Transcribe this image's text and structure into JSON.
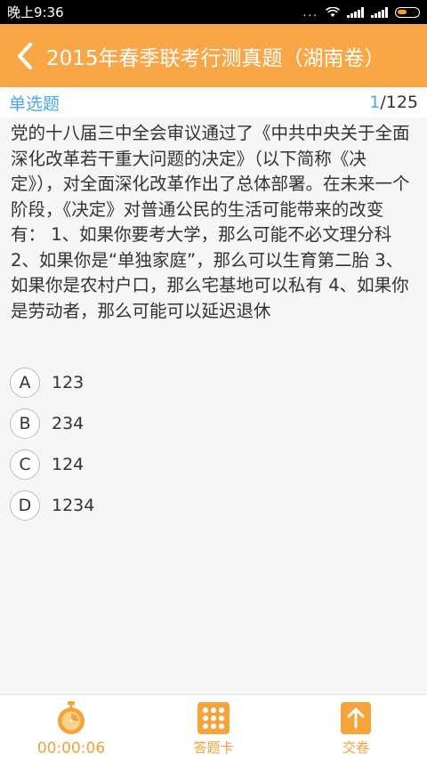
{
  "status_bar": {
    "time": "晚上9:36",
    "more": "..."
  },
  "title_bar": {
    "title": "2015年春季联考行测真题（湖南卷）"
  },
  "question_header": {
    "type": "单选题",
    "current": "1",
    "total": "/125"
  },
  "question": {
    "text": "党的十八届三中全会审议通过了《中共中央关于全面深化改革若干重大问题的决定》（以下简称《决定》），对全面深化改革作出了总体部署。在未来一个阶段，《决定》对普通公民的生活可能带来的改变有： 1、如果你要考大学，那么可能不必文理分科 2、如果你是“单独家庭”，那么可以生育第二胎 3、如果你是农村户口，那么宅基地可以私有 4、如果你是劳动者，那么可能可以延迟退休"
  },
  "options": [
    {
      "letter": "A",
      "text": "123"
    },
    {
      "letter": "B",
      "text": "234"
    },
    {
      "letter": "C",
      "text": "124"
    },
    {
      "letter": "D",
      "text": "1234"
    }
  ],
  "bottom_bar": {
    "timer": "00:00:06",
    "answer_card": "答题卡",
    "submit": "交卷"
  },
  "colors": {
    "accent": "#f9a646",
    "blue": "#4aa7e6"
  }
}
